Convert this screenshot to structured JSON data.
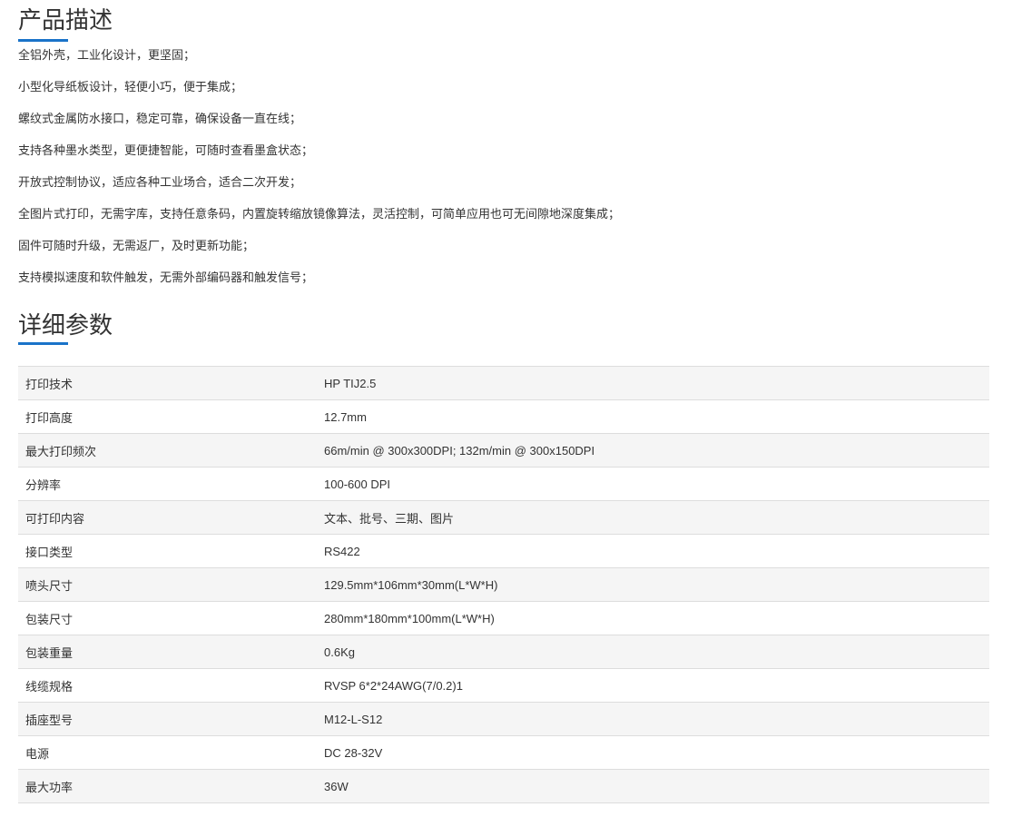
{
  "description": {
    "title": "产品描述",
    "items": [
      "全铝外壳，工业化设计，更坚固；",
      "小型化导纸板设计，轻便小巧，便于集成；",
      "螺纹式金属防水接口，稳定可靠，确保设备一直在线；",
      "支持各种墨水类型，更便捷智能，可随时查看墨盒状态；",
      "开放式控制协议，适应各种工业场合，适合二次开发；",
      "全图片式打印，无需字库，支持任意条码，内置旋转缩放镜像算法，灵活控制，可简单应用也可无间隙地深度集成；",
      "固件可随时升级，无需返厂，及时更新功能；",
      "支持模拟速度和软件触发，无需外部编码器和触发信号；"
    ]
  },
  "params": {
    "title": "详细参数",
    "rows": [
      {
        "key": "打印技术",
        "value": "HP TIJ2.5"
      },
      {
        "key": "打印高度",
        "value": "12.7mm"
      },
      {
        "key": "最大打印频次",
        "value": "66m/min @ 300x300DPI; 132m/min @ 300x150DPI"
      },
      {
        "key": "分辨率",
        "value": "100-600 DPI"
      },
      {
        "key": "可打印内容",
        "value": "文本、批号、三期、图片"
      },
      {
        "key": "接口类型",
        "value": "RS422"
      },
      {
        "key": "喷头尺寸",
        "value": "129.5mm*106mm*30mm(L*W*H)"
      },
      {
        "key": "包装尺寸",
        "value": "280mm*180mm*100mm(L*W*H)"
      },
      {
        "key": "包装重量",
        "value": "0.6Kg"
      },
      {
        "key": "线缆规格",
        "value": "RVSP 6*2*24AWG(7/0.2)1"
      },
      {
        "key": "插座型号",
        "value": "M12-L-S12"
      },
      {
        "key": "电源",
        "value": "DC 28-32V"
      },
      {
        "key": "最大功率",
        "value": "36W"
      }
    ]
  },
  "colors": {
    "accent": "#1a73c9",
    "text": "#333333",
    "row_alt": "#f5f5f5",
    "border": "#dddddd"
  }
}
